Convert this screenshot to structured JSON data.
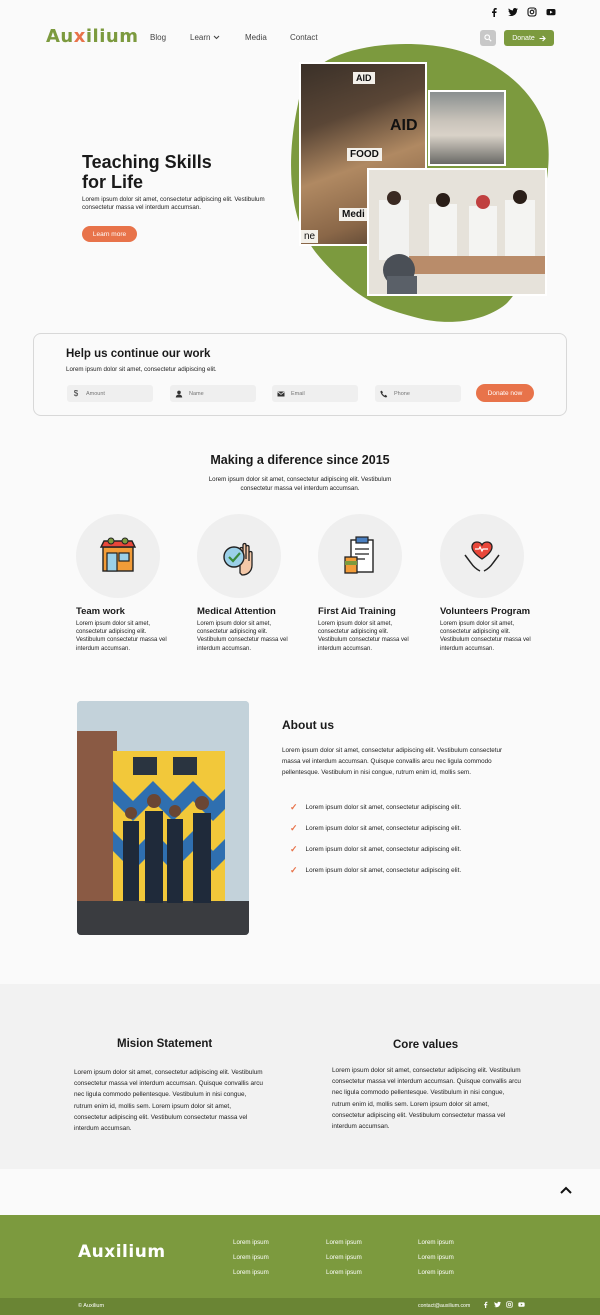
{
  "header": {
    "logo": {
      "pre": "Au",
      "x": "x",
      "post": "ilium"
    },
    "nav": [
      "Blog",
      "Learn",
      "Media",
      "Contact"
    ],
    "donate_label": "Donate"
  },
  "hero": {
    "title": "Teaching Skills for Life",
    "text": "Lorem ipsum dolor sit amet, consectetur adipiscing elit. Vestibulum consectetur massa vel interdum accumsan.",
    "button": "Learn more",
    "box_labels": [
      "AID",
      "AID",
      "FOOD",
      "Medi",
      "ne"
    ]
  },
  "donation_form": {
    "title": "Help us continue our work",
    "subtitle": "Lorem ipsum dolor sit amet, consectetur adipiscing elit.",
    "fields": [
      {
        "placeholder": "Amount",
        "icon": "dollar-icon"
      },
      {
        "placeholder": "Name",
        "icon": "person-icon"
      },
      {
        "placeholder": "Email",
        "icon": "mail-icon"
      },
      {
        "placeholder": "Phone",
        "icon": "phone-icon"
      }
    ],
    "submit": "Donate now"
  },
  "difference": {
    "title": "Making a diference since 2015",
    "text": "Lorem ipsum dolor sit amet, consectetur adipiscing elit. Vestibulum consectetur massa vel interdum accumsan.",
    "services": [
      {
        "title": "Team work",
        "icon": "storefront-icon",
        "text": "Lorem ipsum dolor sit amet, consectetur adipiscing elit. Vestibulum consectetur massa vel interdum accumsan."
      },
      {
        "title": "Medical Attention",
        "icon": "hand-checkmark-icon",
        "text": "Lorem ipsum dolor sit amet, consectetur adipiscing elit. Vestibulum consectetur massa vel interdum accumsan."
      },
      {
        "title": "First Aid Training",
        "icon": "clipboard-icon",
        "text": "Lorem ipsum dolor sit amet, consectetur adipiscing elit. Vestibulum consectetur massa vel interdum accumsan."
      },
      {
        "title": "Volunteers Program",
        "icon": "heart-hands-icon",
        "text": "Lorem ipsum dolor sit amet, consectetur adipiscing elit. Vestibulum consectetur massa vel interdum accumsan."
      }
    ]
  },
  "about": {
    "title": "About us",
    "text": "Lorem ipsum dolor sit amet, consectetur adipiscing elit. Vestibulum consectetur massa vel interdum accumsan. Quisque convallis arcu nec ligula commodo pellentesque. Vestibulum in nisi congue, rutrum enim id, mollis sem.",
    "checks": [
      "Lorem ipsum dolor sit amet, consectetur adipiscing elit.",
      "Lorem ipsum dolor sit amet, consectetur adipiscing elit.",
      "Lorem ipsum dolor sit amet, consectetur adipiscing elit.",
      "Lorem ipsum dolor sit amet, consectetur adipiscing elit."
    ]
  },
  "mission": {
    "title": "Mision Statement",
    "text": "Lorem ipsum dolor sit amet, consectetur adipiscing elit. Vestibulum consectetur massa vel interdum accumsan. Quisque convallis arcu nec ligula commodo pellentesque. Vestibulum in nisi congue, rutrum enim id, mollis sem. Lorem ipsum dolor sit amet, consectetur adipiscing elit. Vestibulum consectetur massa vel interdum accumsan."
  },
  "values": {
    "title": "Core values",
    "text": "Lorem ipsum dolor sit amet, consectetur adipiscing elit. Vestibulum consectetur massa vel interdum accumsan. Quisque convallis arcu nec ligula commodo pellentesque. Vestibulum in nisi congue, rutrum enim id, mollis sem. Lorem ipsum dolor sit amet, consectetur adipiscing elit. Vestibulum consectetur massa vel interdum accumsan."
  },
  "footer": {
    "logo": {
      "pre": "Au",
      "x": "x",
      "post": "ilium"
    },
    "columns": [
      [
        "Lorem ipsum",
        "Lorem ipsum",
        "Lorem ipsum"
      ],
      [
        "Lorem ipsum",
        "Lorem ipsum",
        "Lorem ipsum"
      ],
      [
        "Lorem ipsum",
        "Lorem ipsum",
        "Lorem ipsum"
      ]
    ],
    "copyright": "© Auxilium",
    "email": "contact@auxilium.com"
  },
  "colors": {
    "brand_green": "#7c9a3e",
    "accent_orange": "#e8734a",
    "footer_dark": "#6a8534"
  }
}
